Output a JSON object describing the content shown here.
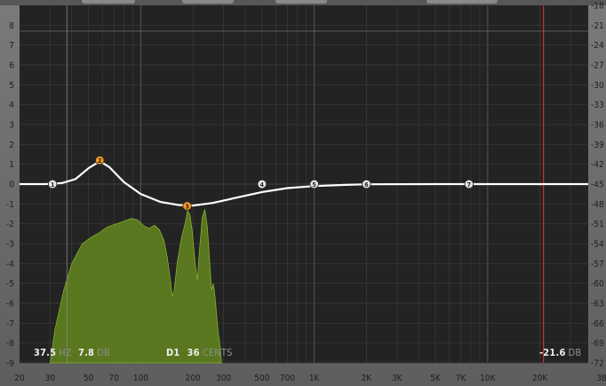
{
  "colors": {
    "panel_bg": "#232323",
    "grid": "#3b3b3b",
    "curve": "#ffffff",
    "spectrum_fill": "#5e7f1e",
    "band_selected": "#ff9a1a",
    "band_default": "#e6e6e6",
    "ceiling_marker": "#ff3030"
  },
  "eq": {
    "freq_axis": {
      "scale": "log",
      "range": [
        20,
        38000
      ],
      "ticks": [
        "20",
        "30",
        "50",
        "70",
        "100",
        "200",
        "300",
        "500",
        "700",
        "1K",
        "2K",
        "3K",
        "5K",
        "7K",
        "10K",
        "20K",
        "38K"
      ]
    },
    "gain_axis_left": {
      "range": [
        -9,
        9
      ],
      "ticks": [
        "8",
        "7",
        "6",
        "5",
        "4",
        "3",
        "2",
        "1",
        "0",
        "-1",
        "-2",
        "-3",
        "-4",
        "-5",
        "-6",
        "-7",
        "-8",
        "-9"
      ]
    },
    "spectrum_axis_right": {
      "range": [
        -72,
        -18
      ],
      "ticks": [
        "-18",
        "-21",
        "-24",
        "-27",
        "-30",
        "-33",
        "-36",
        "-39",
        "-42",
        "-45",
        "-48",
        "-51",
        "-54",
        "-57",
        "-60",
        "-63",
        "-66",
        "-69",
        "-72"
      ]
    },
    "bands": [
      {
        "label": "1",
        "freq": 31,
        "gain": 0.0,
        "state": "normal"
      },
      {
        "label": "2",
        "freq": 58,
        "gain": 1.2,
        "state": "selected"
      },
      {
        "label": "3",
        "freq": 185,
        "gain": -1.1,
        "state": "selected"
      },
      {
        "label": "4",
        "freq": 500,
        "gain": 0.0,
        "state": "normal"
      },
      {
        "label": "5",
        "freq": 1000,
        "gain": 0.0,
        "state": "normal"
      },
      {
        "label": "6",
        "freq": 2000,
        "gain": 0.0,
        "state": "normal"
      },
      {
        "label": "7",
        "freq": 7800,
        "gain": 0.0,
        "state": "normal"
      }
    ],
    "eq_curve": [
      [
        20,
        0
      ],
      [
        28,
        0
      ],
      [
        35,
        0.05
      ],
      [
        42,
        0.25
      ],
      [
        50,
        0.8
      ],
      [
        58,
        1.15
      ],
      [
        66,
        0.85
      ],
      [
        80,
        0.1
      ],
      [
        100,
        -0.5
      ],
      [
        130,
        -0.9
      ],
      [
        165,
        -1.05
      ],
      [
        200,
        -1.08
      ],
      [
        260,
        -0.95
      ],
      [
        350,
        -0.7
      ],
      [
        500,
        -0.4
      ],
      [
        700,
        -0.2
      ],
      [
        1000,
        -0.1
      ],
      [
        1500,
        -0.04
      ],
      [
        2000,
        -0.01
      ],
      [
        5000,
        0
      ],
      [
        38000,
        0
      ]
    ],
    "spectrum": [
      [
        30,
        -72
      ],
      [
        32,
        -67
      ],
      [
        36,
        -61
      ],
      [
        40,
        -57
      ],
      [
        46,
        -54
      ],
      [
        52,
        -53
      ],
      [
        58,
        -52.3
      ],
      [
        64,
        -51.5
      ],
      [
        72,
        -51
      ],
      [
        80,
        -50.6
      ],
      [
        88,
        -50.2
      ],
      [
        96,
        -50.4
      ],
      [
        104,
        -51.3
      ],
      [
        112,
        -51.7
      ],
      [
        120,
        -51.2
      ],
      [
        128,
        -51.9
      ],
      [
        136,
        -53.5
      ],
      [
        142,
        -56
      ],
      [
        148,
        -59.5
      ],
      [
        152,
        -62
      ],
      [
        156,
        -61
      ],
      [
        162,
        -57
      ],
      [
        172,
        -53
      ],
      [
        180,
        -51
      ],
      [
        186,
        -49
      ],
      [
        192,
        -49.6
      ],
      [
        198,
        -52
      ],
      [
        206,
        -57
      ],
      [
        212,
        -59.5
      ],
      [
        218,
        -55
      ],
      [
        226,
        -50
      ],
      [
        234,
        -48.8
      ],
      [
        242,
        -51.5
      ],
      [
        250,
        -57
      ],
      [
        256,
        -61
      ],
      [
        262,
        -60
      ],
      [
        268,
        -62
      ],
      [
        274,
        -65
      ],
      [
        280,
        -67.5
      ],
      [
        286,
        -69.2
      ],
      [
        292,
        -72
      ],
      [
        292,
        -72
      ]
    ],
    "ceiling_freq": 21000,
    "reference_gain": 7.7
  },
  "readouts": {
    "freq_value": "37.5",
    "freq_unit": "HZ",
    "gain_value": "7.8",
    "gain_unit": "DB",
    "note_value": "D1",
    "cents_value": "36",
    "cents_unit": "CENTS",
    "ceiling_value": "-21.6",
    "ceiling_unit": "DB"
  }
}
